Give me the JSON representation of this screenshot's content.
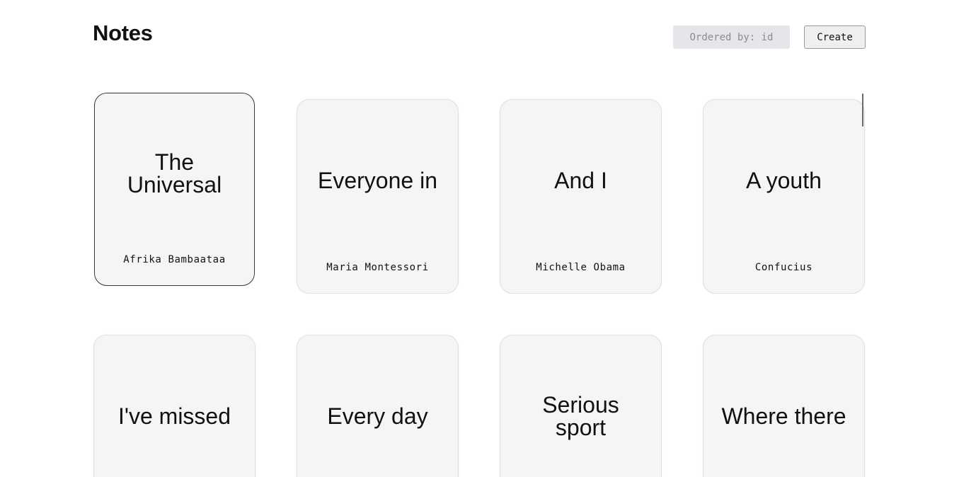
{
  "header": {
    "title": "Notes",
    "order_label": "Ordered by: id",
    "create_label": "Create"
  },
  "notes": [
    {
      "title": "The Universal",
      "author": "Afrika Bambaataa"
    },
    {
      "title": "Everyone in",
      "author": "Maria Montessori"
    },
    {
      "title": "And I",
      "author": "Michelle Obama"
    },
    {
      "title": "A youth",
      "author": "Confucius"
    },
    {
      "title": "I've missed",
      "author": ""
    },
    {
      "title": "Every day",
      "author": ""
    },
    {
      "title": "Serious sport",
      "author": ""
    },
    {
      "title": "Where there",
      "author": ""
    }
  ]
}
